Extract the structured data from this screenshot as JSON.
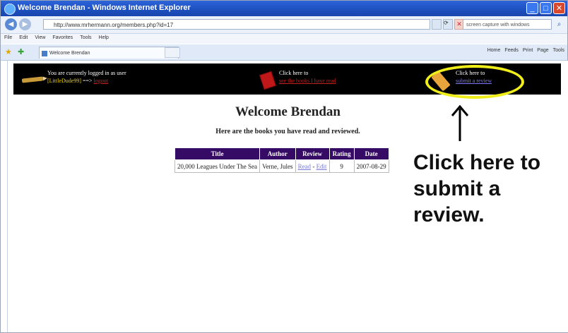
{
  "window": {
    "title": "Welcome Brendan - Windows Internet Explorer",
    "buttons": {
      "minimize": "_",
      "maximize": "□",
      "close": "✕"
    }
  },
  "address": {
    "url": "http://www.mrhermann.org/members.php?id=17",
    "search_placeholder": "screen capture with windows",
    "back_glyph": "◀",
    "forward_glyph": "▶",
    "refresh_glyph": "⟳",
    "stop_glyph": "✕",
    "search_glyph": "⌕"
  },
  "menu": {
    "items": [
      "File",
      "Edit",
      "View",
      "Favorites",
      "Tools",
      "Help"
    ]
  },
  "tabs": {
    "active_label": "Welcome Brendan",
    "star_glyph": "★",
    "add_glyph": "✚",
    "commands": [
      "Home",
      "Feeds",
      "Print",
      "Page",
      "Tools"
    ]
  },
  "banner": {
    "login_line1": "You are currently logged in as user",
    "username": "[LittleDude99]",
    "login_arrow": "==>",
    "logout_label": "logout",
    "books_line1": "Click here to",
    "books_link": "see the books I have read",
    "review_line1": "Click here to",
    "review_link": "submit a review"
  },
  "main": {
    "heading": "Welcome Brendan",
    "subheading": "Here are the books you have read and reviewed.",
    "table": {
      "headers": [
        "Title",
        "Author",
        "Review",
        "Rating",
        "Date"
      ],
      "rows": [
        {
          "title": "20,000 Leagues Under The Sea",
          "author": "Verne, Jules",
          "read": "Read",
          "sep": " - ",
          "edit": "Edit",
          "rating": "9",
          "date": "2007-08-29"
        }
      ]
    }
  },
  "annotation": {
    "callout": "Click here to submit a review.",
    "highlight_color": "#f0ee1a"
  },
  "colors": {
    "table_header": "#360b66",
    "banner_bg": "#000000",
    "username": "#f0d000",
    "logout": "#d02020",
    "review_link": "#7a78ff"
  }
}
